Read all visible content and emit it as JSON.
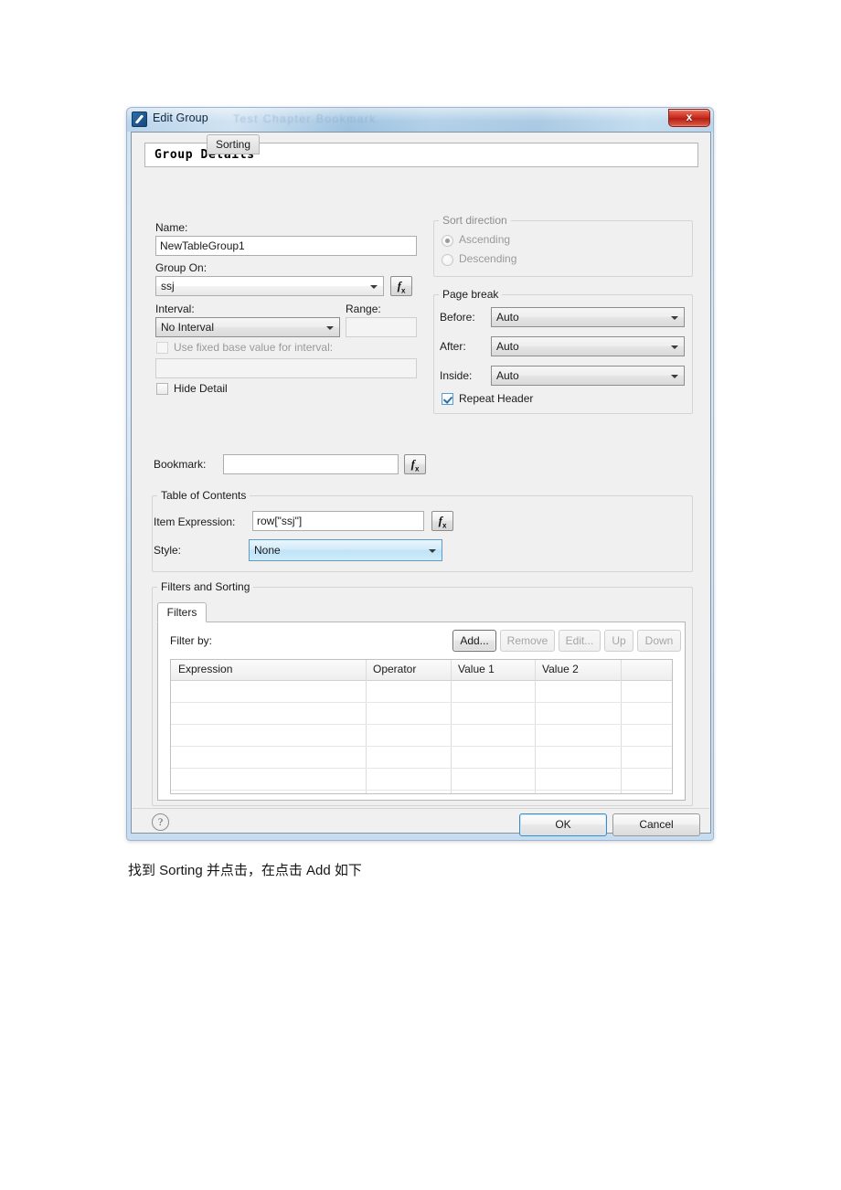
{
  "window": {
    "title": "Edit Group",
    "icon": "app-icon",
    "ghost_title": "Test Chapter Bookmark",
    "close_label": "x"
  },
  "banner": {
    "title": "Group Details"
  },
  "form": {
    "name_label": "Name:",
    "name_value": "NewTableGroup1",
    "group_on_label": "Group On:",
    "group_on_value": "ssj",
    "interval_label": "Interval:",
    "interval_value": "No Interval",
    "range_label": "Range:",
    "range_value": "",
    "fixed_base_label": "Use fixed base value for interval:",
    "fixed_base_value": "",
    "hide_detail_label": "Hide Detail",
    "fx_label": "f",
    "fx_sub": "x"
  },
  "sort_direction": {
    "title": "Sort direction",
    "options": [
      {
        "label": "Ascending",
        "checked": true
      },
      {
        "label": "Descending",
        "checked": false
      }
    ]
  },
  "page_break": {
    "title": "Page break",
    "rows": [
      {
        "label": "Before:",
        "value": "Auto"
      },
      {
        "label": "After:",
        "value": "Auto"
      },
      {
        "label": "Inside:",
        "value": "Auto"
      }
    ],
    "repeat_header_label": "Repeat Header",
    "repeat_header_checked": true
  },
  "bookmark": {
    "label": "Bookmark:",
    "value": ""
  },
  "toc": {
    "title": "Table of Contents",
    "item_expression_label": "Item Expression:",
    "item_expression_value": "row[\"ssj\"]",
    "style_label": "Style:",
    "style_value": "None"
  },
  "filters_sorting": {
    "title": "Filters and Sorting",
    "tabs": [
      {
        "label": "Filters",
        "active": true
      },
      {
        "label": "Sorting",
        "active": false
      }
    ],
    "filter_by_label": "Filter by:",
    "buttons": [
      {
        "label": "Add...",
        "enabled": true
      },
      {
        "label": "Remove",
        "enabled": false
      },
      {
        "label": "Edit...",
        "enabled": false
      },
      {
        "label": "Up",
        "enabled": false
      },
      {
        "label": "Down",
        "enabled": false
      }
    ],
    "table": {
      "columns": [
        "Expression",
        "Operator",
        "Value 1",
        "Value 2",
        ""
      ],
      "rows": []
    }
  },
  "footer": {
    "help_label": "?",
    "ok_label": "OK",
    "cancel_label": "Cancel"
  },
  "caption": {
    "text": "找到 Sorting 并点击，在点击 Add 如下"
  },
  "colors": {
    "accent": "#3c8dbc",
    "close_red": "#c7281c",
    "dialog_bg": "#f0f0f0",
    "focus_blue": "#bfe3f7"
  }
}
